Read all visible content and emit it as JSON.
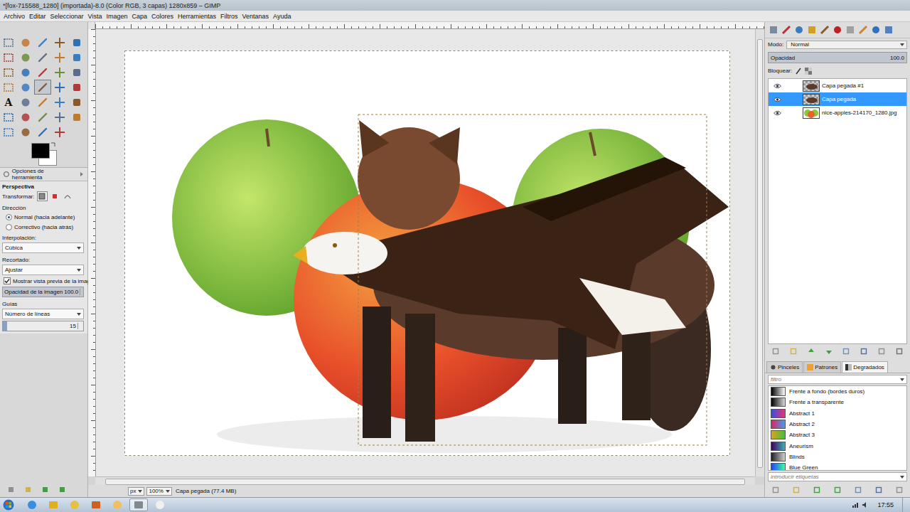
{
  "window": {
    "title": "*[fox-715588_1280] (importada)-8.0 (Color RGB, 3 capas) 1280x859 – GIMP"
  },
  "menu": [
    "Archivo",
    "Editar",
    "Seleccionar",
    "Vista",
    "Imagen",
    "Capa",
    "Colores",
    "Herramientas",
    "Filtros",
    "Ventanas",
    "Ayuda"
  ],
  "toolbox": {
    "tools": [
      {
        "kind": "icon",
        "selected": false
      },
      {
        "kind": "icon",
        "selected": false
      },
      {
        "kind": "icon",
        "selected": false
      },
      {
        "kind": "icon",
        "selected": false
      },
      {
        "kind": "icon",
        "selected": false
      },
      {
        "kind": "icon",
        "selected": false
      },
      {
        "kind": "icon",
        "selected": false
      },
      {
        "kind": "icon",
        "selected": false
      },
      {
        "kind": "icon",
        "selected": false
      },
      {
        "kind": "icon",
        "selected": false
      },
      {
        "kind": "icon",
        "selected": false
      },
      {
        "kind": "icon",
        "selected": false
      },
      {
        "kind": "icon",
        "selected": false
      },
      {
        "kind": "icon",
        "selected": false
      },
      {
        "kind": "icon",
        "selected": false
      },
      {
        "kind": "icon",
        "selected": false
      },
      {
        "kind": "icon",
        "selected": false
      },
      {
        "kind": "icon",
        "selected": true
      },
      {
        "kind": "icon",
        "selected": false
      },
      {
        "kind": "icon",
        "selected": false
      },
      {
        "kind": "glyph",
        "glyph": "A",
        "selected": false
      },
      {
        "kind": "icon",
        "selected": false
      },
      {
        "kind": "icon",
        "selected": false
      },
      {
        "kind": "icon",
        "selected": false
      },
      {
        "kind": "icon",
        "selected": false
      },
      {
        "kind": "icon",
        "selected": false
      },
      {
        "kind": "icon",
        "selected": false
      },
      {
        "kind": "icon",
        "selected": false
      },
      {
        "kind": "icon",
        "selected": false
      },
      {
        "kind": "icon",
        "selected": false
      },
      {
        "kind": "icon",
        "selected": false
      },
      {
        "kind": "icon",
        "selected": false
      },
      {
        "kind": "icon",
        "selected": false
      },
      {
        "kind": "icon",
        "selected": false
      }
    ],
    "fg_color": "#000000",
    "bg_color": "#ffffff"
  },
  "tool_options": {
    "header": "Opciones de herramienta",
    "tool_name": "Perspectiva",
    "transform_label": "Transformar:",
    "transform_modes": [
      {
        "selected": true
      },
      {
        "selected": false
      },
      {
        "selected": false
      }
    ],
    "direction_label": "Dirección",
    "directions": [
      {
        "label": "Normal (hacia adelante)",
        "selected": true
      },
      {
        "label": "Correctivo (hacia atrás)",
        "selected": false
      }
    ],
    "interpolation_label": "Interpolación:",
    "interpolation": "Cúbica",
    "clipping_label": "Recortado:",
    "clipping": "Ajustar",
    "preview": {
      "label": "Mostrar vista previa de la imagen",
      "checked": true
    },
    "opacity": {
      "label": "Opacidad de la imagen",
      "value": "100.0",
      "level": 1
    },
    "guides_label": "Guías",
    "guides": "Número de líneas",
    "lines": {
      "value": "15",
      "level": 0.05
    }
  },
  "status_bar": {
    "unit": "px",
    "zoom": "100%",
    "text": "Capa pegada (77.4 MB)"
  },
  "layers_panel": {
    "mode_label": "Modo:",
    "mode": "Normal",
    "opacity_label": "Opacidad",
    "opacity": "100.0",
    "opacity_level": 1,
    "lock_label": "Bloquear:",
    "layers": [
      {
        "name": "Capa pegada #1",
        "visible": true,
        "selected": false,
        "kind": "transparent"
      },
      {
        "name": "Capa pegada",
        "visible": true,
        "selected": true,
        "kind": "transparent"
      },
      {
        "name": "nice-apples-214170_1280.jpg",
        "visible": true,
        "selected": false,
        "kind": "opaque"
      }
    ]
  },
  "resources": {
    "tabs": [
      {
        "label": "Pinceles",
        "selected": false
      },
      {
        "label": "Patrones",
        "selected": false
      },
      {
        "label": "Degradados",
        "selected": true
      }
    ],
    "filter_placeholder": "filtro",
    "gradients": [
      {
        "label": "Frente a fondo (bordes duros)",
        "color": "#000000",
        "end_color": "#ffffff"
      },
      {
        "label": "Frente a transparente",
        "color": "#000000",
        "end_color": "#d8d8d8"
      },
      {
        "label": "Abstract 1",
        "color": "#3050e0",
        "end_color": "#f03070"
      },
      {
        "label": "Abstract 2",
        "color": "#e02060",
        "end_color": "#40a0f0"
      },
      {
        "label": "Abstract 3",
        "color": "#e0a020",
        "end_color": "#40c040"
      },
      {
        "label": "Aneurism",
        "color": "#400060",
        "end_color": "#40b0b0"
      },
      {
        "label": "Blinds",
        "color": "#202020",
        "end_color": "#d0d0d0"
      },
      {
        "label": "Blue Green",
        "color": "#2040ff",
        "end_color": "#40ffa0"
      }
    ],
    "tags_placeholder": "introducir etiquetas"
  },
  "taskbar": {
    "time": "17:55"
  }
}
